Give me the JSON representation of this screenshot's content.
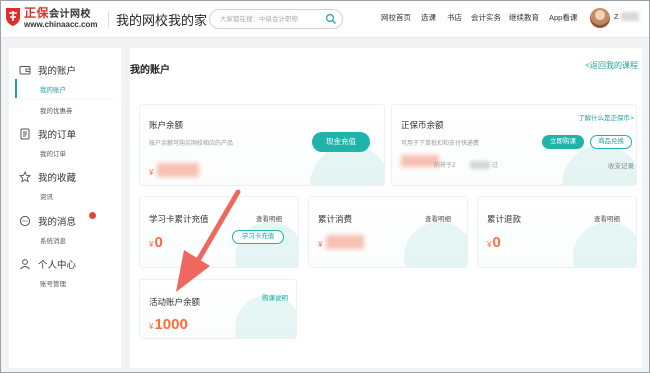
{
  "header": {
    "logo_brand": "正保",
    "logo_sub": "会计网校",
    "logo_url": "www.chinaacc.com",
    "site_title": "我的网校我的家",
    "search_placeholder": "大家都在搜：中级会计职称",
    "nav": [
      "网校首页",
      "选课",
      "书店",
      "会计实务",
      "继续教育",
      "App看课"
    ],
    "user_initial": "Z"
  },
  "sidebar": {
    "groups": [
      {
        "label": "我的账户",
        "icon": "wallet-icon",
        "subs": [
          "我的账户",
          "我的优惠券"
        ]
      },
      {
        "label": "我的订单",
        "icon": "order-icon",
        "subs": [
          "我的订单"
        ]
      },
      {
        "label": "我的收藏",
        "icon": "star-icon",
        "subs": [
          "资讯"
        ]
      },
      {
        "label": "我的消息",
        "icon": "message-icon",
        "subs": [
          "系统消息"
        ]
      },
      {
        "label": "个人中心",
        "icon": "user-icon",
        "subs": [
          "账号管理"
        ]
      }
    ]
  },
  "main": {
    "title": "我的账户",
    "back_link": "<返回我的课程",
    "balance_card": {
      "title": "账户余额",
      "desc": "账户余额可购买网校相应的产品",
      "currency": "¥",
      "button": "现金充值"
    },
    "coin_card": {
      "title": "正保币余额",
      "desc": "可用于下单抵扣和支付快递费",
      "help_link": "了解什么是正保币>",
      "buy_button": "立即购课",
      "exchange_button": "商品兑换",
      "expire_text": "的将于2",
      "expire_suffix": "过",
      "record_link": "收支记录"
    },
    "study_card": {
      "title": "学习卡累计充值",
      "detail_link": "查看明细",
      "amount": "0",
      "currency": "¥",
      "button": "学习卡充值"
    },
    "consume_card": {
      "title": "累计消费",
      "detail_link": "查看明细",
      "currency": "¥"
    },
    "refund_card": {
      "title": "累计退款",
      "detail_link": "查看明细",
      "currency": "¥",
      "amount": "0"
    },
    "activity_card": {
      "title": "活动账户余额",
      "rule_link": "购课说明",
      "currency": "¥",
      "amount": "1000"
    }
  },
  "colors": {
    "accent": "#1fb3aa",
    "amount": "#ff6a3d",
    "annotation_arrow": "#ee6860",
    "brand_red": "#d9302a"
  }
}
